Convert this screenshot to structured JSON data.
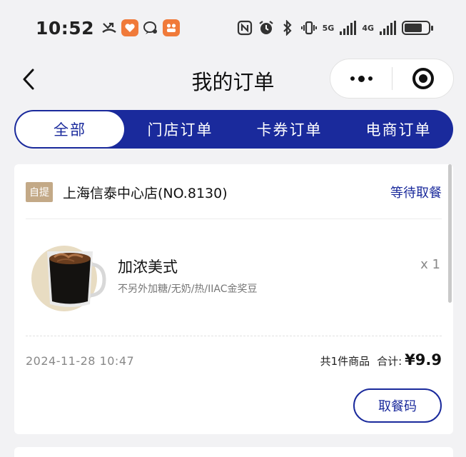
{
  "status_bar": {
    "time": "10:52",
    "network_1": "5G",
    "network_2": "4G",
    "battery_level": 0.75,
    "icons": [
      "missed-call-icon",
      "heart-app-icon",
      "chat-icon",
      "app-grid-icon",
      "nfc-icon",
      "alarm-icon",
      "bluetooth-icon",
      "vibrate-icon",
      "signal-icon",
      "battery-icon"
    ]
  },
  "nav": {
    "title": "我的订单",
    "back_icon": "chevron-left-icon",
    "more_icon": "more-dots-icon",
    "close_icon": "target-close-icon"
  },
  "tabs": [
    {
      "label": "全部",
      "active": true
    },
    {
      "label": "门店订单",
      "active": false
    },
    {
      "label": "卡券订单",
      "active": false
    },
    {
      "label": "电商订单",
      "active": false
    }
  ],
  "order": {
    "pickup_tag": "自提",
    "store_name": "上海信泰中心店(NO.8130)",
    "status": "等待取餐",
    "product": {
      "name": "加浓美式",
      "spec": "不另外加糖/无奶/热/IIAC金奖豆",
      "qty": "x 1"
    },
    "time": "2024-11-28 10:47",
    "count_text": "共1件商品",
    "total_label": "合计:",
    "total": "¥9.9",
    "action_button": "取餐码"
  },
  "colors": {
    "brand_blue": "#1a2a9c",
    "tag_gold": "#c3a987",
    "background": "#f2f2f4"
  }
}
